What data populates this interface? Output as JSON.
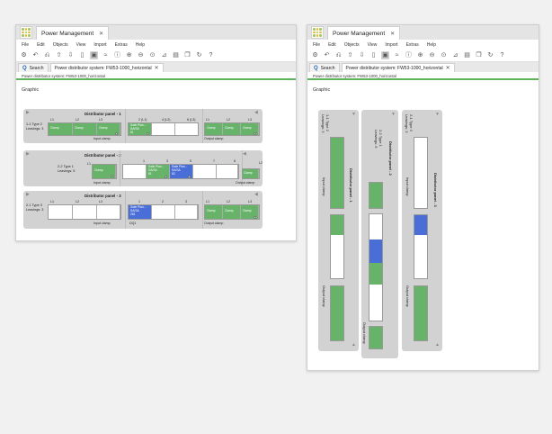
{
  "app": {
    "title": "Power Management"
  },
  "menu": [
    "File",
    "Edit",
    "Objects",
    "View",
    "Import",
    "Extras",
    "Help"
  ],
  "toolbar_icons": [
    "settings-icon",
    "undo-icon",
    "redo-icon",
    "upload-icon",
    "download-icon",
    "delete-icon",
    "panel-icon",
    "chart-icon",
    "info-icon",
    "zoom-in-icon",
    "zoom-out-icon",
    "zoom-fit-icon",
    "sort-icon",
    "save-icon",
    "copy-icon",
    "refresh-icon",
    "help-icon"
  ],
  "tabs": {
    "search": "Search",
    "doc": "Power distributor system: FW53-1000_horizontal"
  },
  "breadcrumb": "Power distributor system: FW53-1000_horizontal",
  "heading": "Graphic",
  "panels": [
    {
      "title": "Distributor panel - 1",
      "info": "1-1 Type 2\nLeavings: 3"
    },
    {
      "title": "Distributor panel - 2",
      "info": "2-2 Type 1\nLeavings: 5"
    },
    {
      "title": "Distributor panel - 3",
      "info": "2-1 Type 3\nLeavings: 3"
    }
  ],
  "labels": {
    "l1": "L1",
    "l2": "L2",
    "l3": "L3",
    "clamp": "Clamp",
    "input_clamp": "Input clamp",
    "output_clamp": "Output clamp",
    "h1": "1",
    "h2": "2",
    "h3": "3",
    "h4": "4",
    "h5": "5",
    "h6": "6",
    "h7": "7",
    "h8": "8",
    "h21": "2 (L1)",
    "h42": "4 (L2)",
    "h63": "6 (L3)",
    "swle": "Swle Plan...\nSA/SA\n81",
    "swle1": "Swle Plan...\nSA/SA\n81",
    "swle2": "Swle Plan...\nSA/SA\n82",
    "swle3": "Swle Plan...\nSA/SA\n281",
    "swle_v": "Swle Plan... SA/SA 82",
    "dq": "DQ1",
    "l2sm": "L2"
  }
}
